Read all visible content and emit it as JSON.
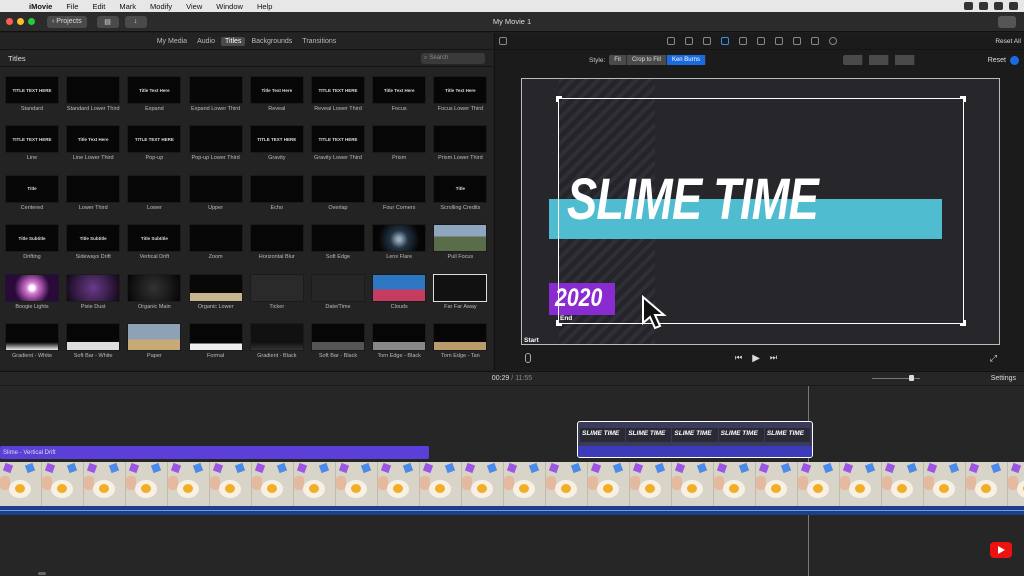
{
  "menubar": {
    "app": "iMovie",
    "items": [
      "File",
      "Edit",
      "Mark",
      "Modify",
      "View",
      "Window",
      "Help"
    ]
  },
  "toolbar": {
    "projects_label": "Projects",
    "window_title": "My Movie 1"
  },
  "browser": {
    "tabs": [
      "My Media",
      "Audio",
      "Titles",
      "Backgrounds",
      "Transitions"
    ],
    "active_tab": "Titles",
    "heading": "Titles",
    "search_placeholder": "Search",
    "titles": [
      {
        "label": "Standard",
        "preview": "TITLE TEXT HERE"
      },
      {
        "label": "Standard Lower Third",
        "preview": ""
      },
      {
        "label": "Expand",
        "preview": "Title Text Here"
      },
      {
        "label": "Expand Lower Third",
        "preview": ""
      },
      {
        "label": "Reveal",
        "preview": "Title Text Here"
      },
      {
        "label": "Reveal Lower Third",
        "preview": "TITLE TEXT HERE"
      },
      {
        "label": "Focus",
        "preview": "Title Text Here"
      },
      {
        "label": "Focus Lower Third",
        "preview": "Title Text Here"
      },
      {
        "label": "Line",
        "preview": "TITLE TEXT HERE"
      },
      {
        "label": "Line Lower Third",
        "preview": "Title Text Here"
      },
      {
        "label": "Pop-up",
        "preview": "TITLE TEXT HERE"
      },
      {
        "label": "Pop-up Lower Third",
        "preview": ""
      },
      {
        "label": "Gravity",
        "preview": "TITLE TEXT HERE"
      },
      {
        "label": "Gravity Lower Third",
        "preview": "TITLE TEXT HERE"
      },
      {
        "label": "Prism",
        "preview": ""
      },
      {
        "label": "Prism Lower Third",
        "preview": ""
      },
      {
        "label": "Centered",
        "preview": "Title"
      },
      {
        "label": "Lower Third",
        "preview": ""
      },
      {
        "label": "Lower",
        "preview": ""
      },
      {
        "label": "Upper",
        "preview": ""
      },
      {
        "label": "Echo",
        "preview": ""
      },
      {
        "label": "Overlap",
        "preview": ""
      },
      {
        "label": "Four Corners",
        "preview": ""
      },
      {
        "label": "Scrolling Credits",
        "preview": "Title"
      },
      {
        "label": "Drifting",
        "preview": "Title Subtitle"
      },
      {
        "label": "Sideways Drift",
        "preview": "Title Subtitle"
      },
      {
        "label": "Vertical Drift",
        "preview": "Title Subtitle"
      },
      {
        "label": "Zoom",
        "preview": ""
      },
      {
        "label": "Horizontal Blur",
        "preview": ""
      },
      {
        "label": "Soft Edge",
        "preview": ""
      },
      {
        "label": "Lens Flare",
        "preview": ""
      },
      {
        "label": "Pull Focus",
        "preview": ""
      },
      {
        "label": "Boogie Lights",
        "preview": ""
      },
      {
        "label": "Pixie Dust",
        "preview": ""
      },
      {
        "label": "Organic Main",
        "preview": ""
      },
      {
        "label": "Organic Lower",
        "preview": ""
      },
      {
        "label": "Ticker",
        "preview": ""
      },
      {
        "label": "Date/Time",
        "preview": ""
      },
      {
        "label": "Clouds",
        "preview": ""
      },
      {
        "label": "Far Far Away",
        "preview": ""
      },
      {
        "label": "Gradient - White",
        "preview": ""
      },
      {
        "label": "Soft Bar - White",
        "preview": ""
      },
      {
        "label": "Paper",
        "preview": ""
      },
      {
        "label": "Formal",
        "preview": ""
      },
      {
        "label": "Gradient - Black",
        "preview": ""
      },
      {
        "label": "Soft Bar - Black",
        "preview": ""
      },
      {
        "label": "Torn Edge - Black",
        "preview": ""
      },
      {
        "label": "Torn Edge - Tan",
        "preview": ""
      }
    ]
  },
  "viewer": {
    "reset_all": "Reset All",
    "style_label": "Style:",
    "style_options": [
      "Fit",
      "Crop to Fill",
      "Ken Burns"
    ],
    "style_selected": "Ken Burns",
    "reset": "Reset",
    "main_title": "SLIME TIME",
    "subtitle": "2020",
    "start_label": "Start",
    "end_label": "End"
  },
  "timeline": {
    "current_time": "00:29",
    "separator": "/",
    "total_time": "11:55",
    "settings_label": "Settings",
    "title_clip_label": "Slime - Vertical Drift",
    "title_clip_frames": [
      "SLIME TIME",
      "SLIME TIME",
      "SLIME TIME",
      "SLIME TIME",
      "SLIME TIME"
    ]
  },
  "colors": {
    "accent": "#1a6be0",
    "title_bar": "#50bcd0",
    "subtitle_box": "#8a2bd0",
    "title_clip": "#5b3fd8",
    "audio": "#1d3f8a"
  }
}
